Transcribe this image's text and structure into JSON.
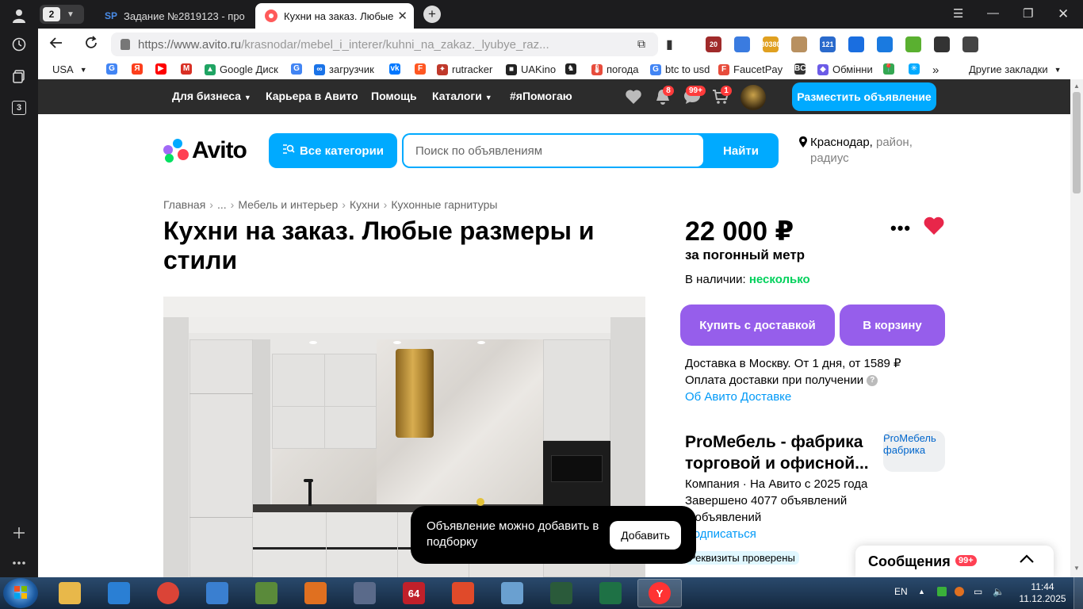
{
  "browser": {
    "tab_count": "2",
    "tabs": [
      {
        "label": "Задание №2819123 - про",
        "favicon": "SP"
      },
      {
        "label": "Кухни на заказ. Любые"
      }
    ],
    "url_host": "https://www.avito.ru",
    "url_path": "/krasnodar/mebel_i_interer/kuhni_na_zakaz._lyubye_raz...",
    "extensions": [
      {
        "label": "20",
        "color": "#a02a2a"
      },
      {
        "label": "",
        "color": "#3a7be0"
      },
      {
        "label": "80380",
        "color": "#e0a020"
      },
      {
        "label": "",
        "color": "#b89060"
      },
      {
        "label": "121",
        "color": "#2a6acc"
      },
      {
        "label": "",
        "color": "#1a6ee0"
      },
      {
        "label": "",
        "color": "#1a7ae0"
      },
      {
        "label": "",
        "color": "#5ab030"
      },
      {
        "label": "",
        "color": "#333333"
      },
      {
        "label": "",
        "color": "#444444"
      }
    ],
    "bookmarks": [
      {
        "label": "USA",
        "color": "#ffffff"
      },
      {
        "label": "",
        "icon": "G",
        "color": "#4285f4"
      },
      {
        "label": "",
        "icon": "Я",
        "color": "#fc3f1d"
      },
      {
        "label": "",
        "icon": "▶",
        "color": "#ff0000"
      },
      {
        "label": "",
        "icon": "M",
        "color": "#d93025"
      },
      {
        "label": "Google Диск",
        "icon": "▲",
        "color": "#1fa463"
      },
      {
        "label": "",
        "icon": "G",
        "color": "#4285f4"
      },
      {
        "label": "загрузчик",
        "icon": "∞",
        "color": "#1a73e8"
      },
      {
        "label": "",
        "icon": "vk",
        "color": "#0077ff"
      },
      {
        "label": "",
        "icon": "F",
        "color": "#ff5722"
      },
      {
        "label": "rutracker",
        "icon": "✦",
        "color": "#c0392b"
      },
      {
        "label": "UAKino",
        "icon": "■",
        "color": "#222222"
      },
      {
        "label": "",
        "icon": "♞",
        "color": "#222222"
      },
      {
        "label": "погода",
        "icon": "🌡",
        "color": "#e74c3c"
      },
      {
        "label": "btc to usd",
        "icon": "G",
        "color": "#4285f4"
      },
      {
        "label": "FaucetPay",
        "icon": "F",
        "color": "#e74c3c"
      },
      {
        "label": "",
        "icon": "BC",
        "color": "#333333"
      },
      {
        "label": "Обмінни",
        "icon": "◆",
        "color": "#6c5ce7"
      },
      {
        "label": "",
        "icon": "📍",
        "color": "#34a853"
      },
      {
        "label": "",
        "icon": "✳",
        "color": "#00aaff"
      }
    ],
    "other_bookmarks": "Другие закладки"
  },
  "avito": {
    "nav": [
      {
        "label": "Для бизнеса",
        "dropdown": true
      },
      {
        "label": "Карьера в Авито"
      },
      {
        "label": "Помощь"
      },
      {
        "label": "Каталоги",
        "dropdown": true
      },
      {
        "label": "#яПомогаю"
      }
    ],
    "badges": {
      "notifications": "8",
      "messages": "99+",
      "cart": "1"
    },
    "place_ad": "Разместить объявление",
    "logo": "Avito",
    "categories_btn": "Все категории",
    "search_placeholder": "Поиск по объявлениям",
    "find_btn": "Найти",
    "location_city": "Краснодар,",
    "location_rest": "район, радиус",
    "breadcrumbs": [
      "Главная",
      "...",
      "Мебель и интерьер",
      "Кухни",
      "Кухонные гарнитуры"
    ],
    "title": "Кухни на заказ. Любые размеры и стили",
    "price": "22 000 ₽",
    "price_unit": "за погонный метр",
    "stock_label": "В наличии:",
    "stock_value": "несколько",
    "buy_btn": "Купить с доставкой",
    "cart_btn": "В корзину",
    "delivery_line1": "Доставка в Москву. От 1 дня, от 1589 ₽",
    "delivery_line2": "Оплата доставки при получении",
    "delivery_link": "Об Авито Доставке",
    "seller_name_1": "ProМебель - фабрика",
    "seller_name_2": "торговой и офисной...",
    "seller_logo_alt": "ProМебель фабрика",
    "seller_type": "Компания · На Авито с 2025 года",
    "seller_done": "Завершено 4077 объявлений",
    "seller_active": "3 объявлений",
    "seller_subscribe": "Подписаться",
    "seller_badge": "Реквизиты проверены",
    "toast_text": "Объявление можно добавить в подборку",
    "toast_btn": "Добавить",
    "messages_title": "Сообщения",
    "messages_badge": "99+"
  },
  "taskbar": {
    "apps": [
      {
        "icon": "folder-icon",
        "label": "",
        "color": "#e8b84a"
      },
      {
        "icon": "shield-icon",
        "label": "",
        "color": "#2a7fd4"
      },
      {
        "icon": "chrome-icon",
        "label": "",
        "color": "#db4437"
      },
      {
        "icon": "globe-icon",
        "label": "",
        "color": "#3a7fd0"
      },
      {
        "icon": "board-icon",
        "label": "",
        "color": "#5a8a3a"
      },
      {
        "icon": "player-icon",
        "label": "",
        "color": "#e07020"
      },
      {
        "icon": "clock-icon",
        "label": "",
        "color": "#5a6a8a"
      },
      {
        "icon": "aida64-icon",
        "label": "64",
        "color": "#c0202a"
      },
      {
        "icon": "pie-chart-icon",
        "label": "",
        "color": "#e04a2a"
      },
      {
        "icon": "notepad-icon",
        "label": "",
        "color": "#6aa0d0"
      },
      {
        "icon": "terminal-icon",
        "label": "",
        "color": "#2a5a3a"
      },
      {
        "icon": "excel-icon",
        "label": "",
        "color": "#1e7145"
      },
      {
        "icon": "yandex-icon",
        "label": "Y",
        "color": "#ff3333"
      }
    ],
    "lang": "EN",
    "time": "11:44",
    "date": "11.12.2025"
  }
}
